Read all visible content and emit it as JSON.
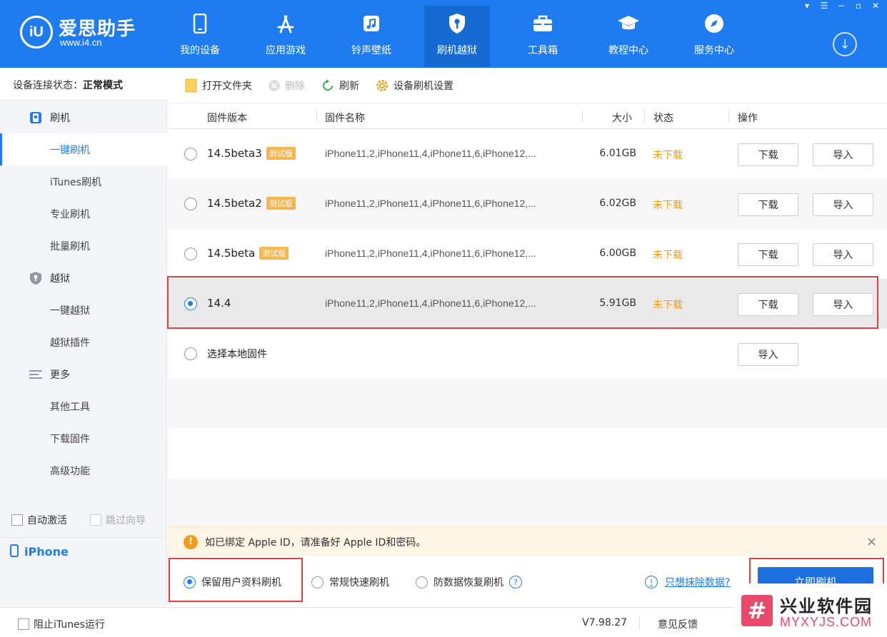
{
  "app": {
    "logo_name": "爱思助手",
    "logo_url": "www.i4.cn",
    "logo_badge": "iU"
  },
  "nav": [
    {
      "label": "我的设备",
      "icon": "phone-icon"
    },
    {
      "label": "应用游戏",
      "icon": "app-store-icon"
    },
    {
      "label": "铃声壁纸",
      "icon": "music-icon"
    },
    {
      "label": "刷机越狱",
      "icon": "shield-key-icon",
      "active": true
    },
    {
      "label": "工具箱",
      "icon": "toolbox-icon"
    },
    {
      "label": "教程中心",
      "icon": "graduation-cap-icon"
    },
    {
      "label": "服务中心",
      "icon": "compass-icon"
    }
  ],
  "sidebar": {
    "status_label": "设备连接状态：",
    "status_value": "正常模式",
    "groups": [
      {
        "label": "刷机",
        "icon": "flash-icon"
      },
      {
        "label": "越狱",
        "icon": "shield-icon"
      },
      {
        "label": "更多",
        "icon": "menu-icon"
      }
    ],
    "items": [
      "一键刷机",
      "iTunes刷机",
      "专业刷机",
      "批量刷机",
      "一键越狱",
      "越狱插件",
      "其他工具",
      "下载固件",
      "高级功能"
    ],
    "auto_activate": "自动激活",
    "skip_guide": "跳过向导",
    "device": "iPhone"
  },
  "toolbar": {
    "open_folder": "打开文件夹",
    "delete": "删除",
    "refresh": "刷新",
    "settings": "设备刷机设置"
  },
  "table": {
    "headers": {
      "version": "固件版本",
      "name": "固件名称",
      "size": "大小",
      "status": "状态",
      "action": "操作"
    },
    "rows": [
      {
        "version": "14.5beta3",
        "tag": "测试版",
        "name": "iPhone11,2,iPhone11,4,iPhone11,6,iPhone12,...",
        "size": "6.01GB",
        "status": "未下载",
        "selected": false
      },
      {
        "version": "14.5beta2",
        "tag": "测试版",
        "name": "iPhone11,2,iPhone11,4,iPhone11,6,iPhone12,...",
        "size": "6.02GB",
        "status": "未下载",
        "selected": false
      },
      {
        "version": "14.5beta",
        "tag": "测试版",
        "name": "iPhone11,2,iPhone11,4,iPhone11,6,iPhone12,...",
        "size": "6.00GB",
        "status": "未下载",
        "selected": false
      },
      {
        "version": "14.4",
        "tag": "",
        "name": "iPhone11,2,iPhone11,4,iPhone11,6,iPhone12,...",
        "size": "5.91GB",
        "status": "未下载",
        "selected": true
      }
    ],
    "download_label": "下载",
    "import_label": "导入",
    "local_label": "选择本地固件"
  },
  "notice": {
    "text": "如已绑定 Apple ID，请准备好 Apple ID和密码。",
    "close": "×"
  },
  "options": {
    "keep_data": "保留用户资料刷机",
    "quick": "常规快速刷机",
    "anti_recovery": "防数据恢复刷机",
    "erase_link": "只想抹除数据?",
    "flash_now": "立即刷机"
  },
  "statusbar": {
    "block_itunes": "阻止iTunes运行",
    "version": "V7.98.27",
    "feedback": "意见反馈"
  },
  "watermark": {
    "title": "兴业软件园",
    "url": "MYXYJS.COM",
    "mark": "#"
  },
  "colors": {
    "brand": "#1e7cf0",
    "warning": "#f39c12",
    "highlight": "#e0413a"
  }
}
